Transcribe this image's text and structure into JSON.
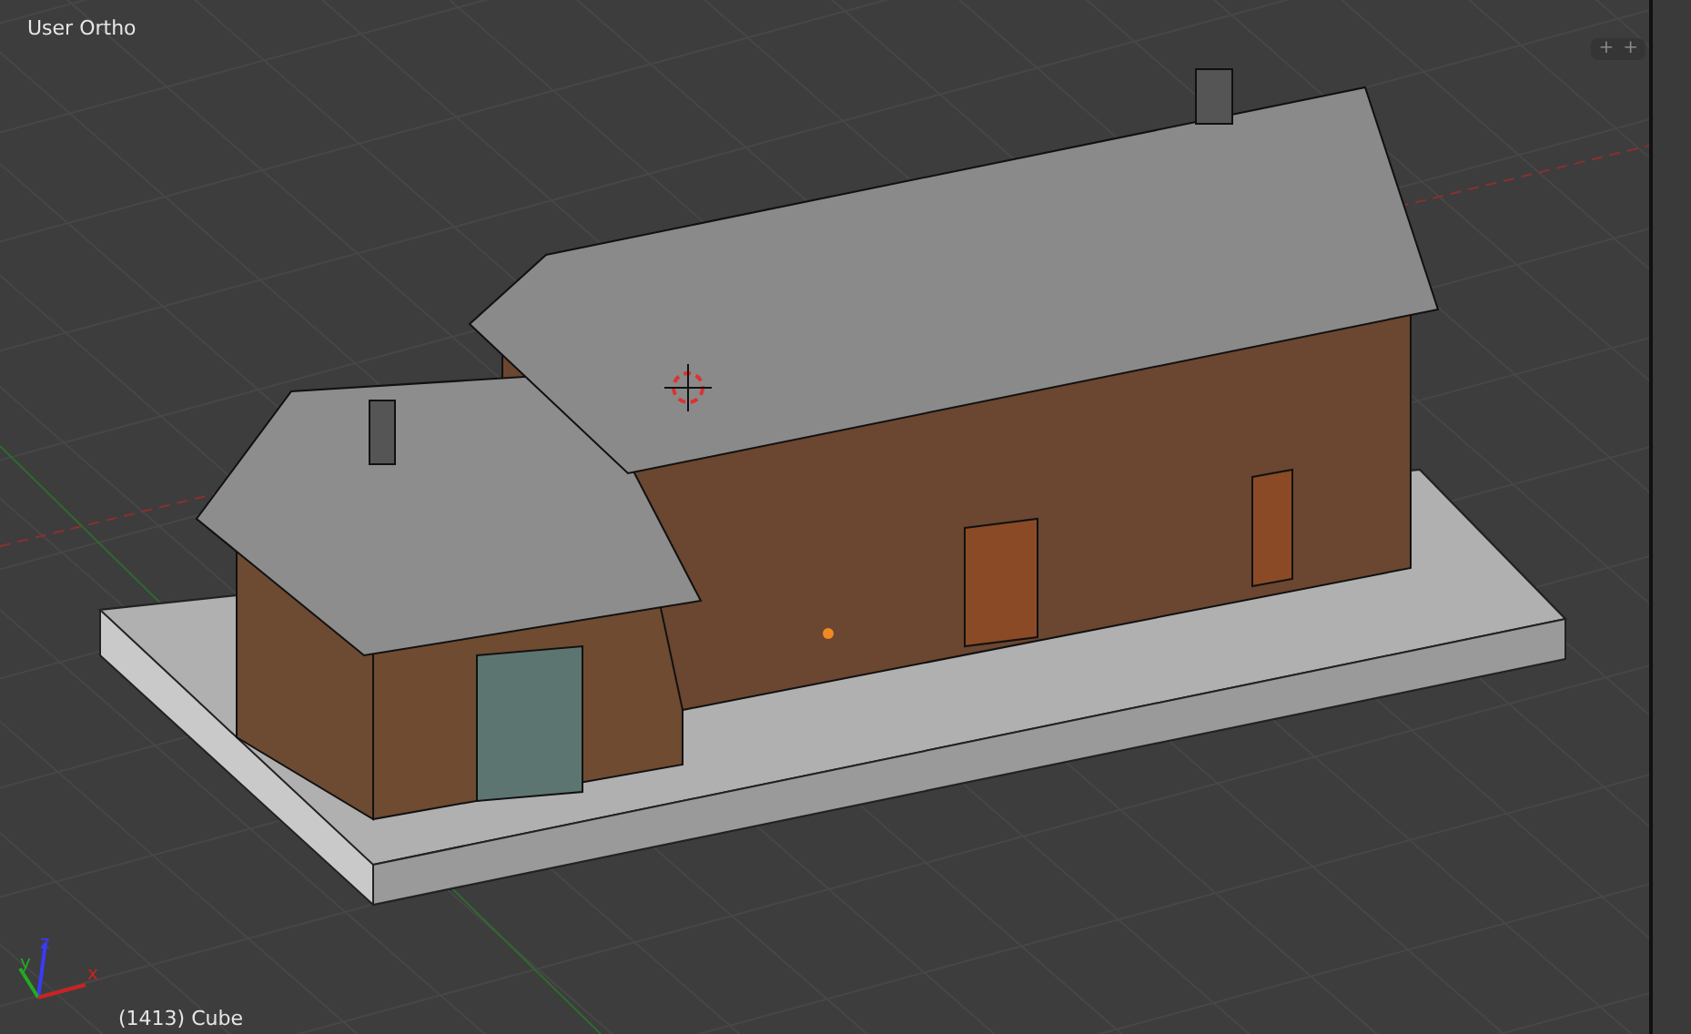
{
  "viewport": {
    "view_label": "User Ortho",
    "object_label": "(1413) Cube",
    "axes": [
      {
        "label": "z",
        "color": "#3a3aff"
      },
      {
        "label": "y",
        "color": "#22aa22"
      },
      {
        "label": "x",
        "color": "#cc2222"
      }
    ]
  },
  "region_buttons": [
    "+",
    "+"
  ]
}
